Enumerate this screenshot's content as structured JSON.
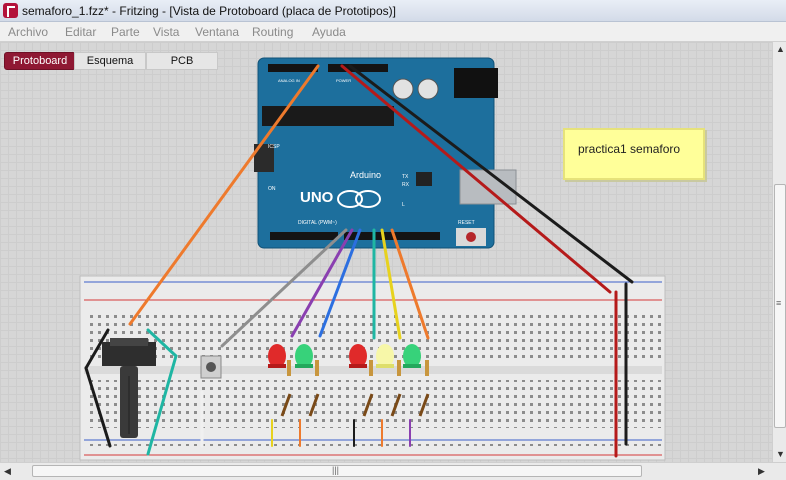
{
  "window": {
    "title": "semaforo_1.fzz* - Fritzing - [Vista de Protoboard (placa de Prototipos)]"
  },
  "menu": [
    "Archivo",
    "Editar",
    "Parte",
    "Vista",
    "Ventana",
    "Routing",
    "Ayuda"
  ],
  "tabs": [
    {
      "label": "Protoboard",
      "active": true
    },
    {
      "label": "Esquema",
      "active": false
    },
    {
      "label": "PCB",
      "active": false
    }
  ],
  "note": {
    "text": "practica1 semaforo"
  },
  "arduino": {
    "model": "UNO",
    "brand": "Arduino",
    "digital_label": "DIGITAL (PWM~)",
    "reset_label": "RESET",
    "icsp_label": "ICSP",
    "tx": "TX",
    "rx": "RX",
    "on": "ON",
    "l": "L",
    "power_label": "POWER",
    "analog_label": "ANALOG IN"
  },
  "colors": {
    "accent": "#8f1833",
    "board": "#1e6fa0",
    "breadboard": "#e8e8e8",
    "note": "#ffff99"
  }
}
